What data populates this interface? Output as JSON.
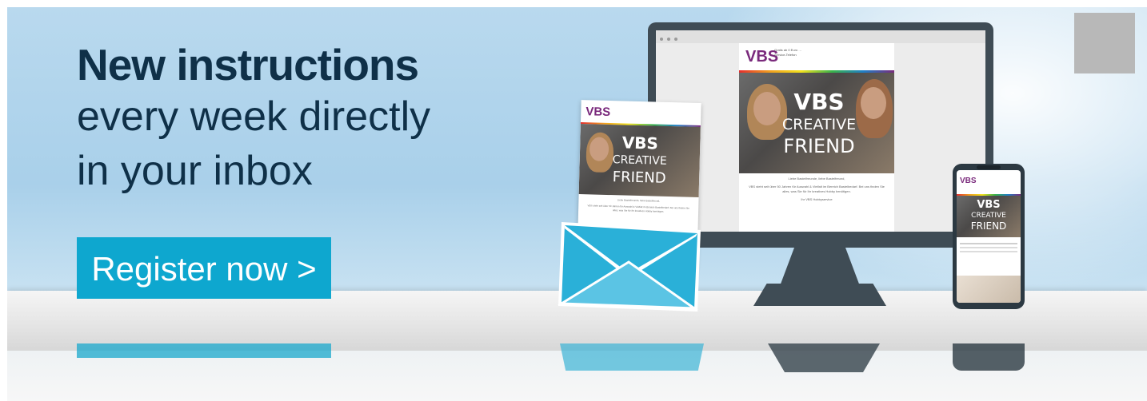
{
  "headline": {
    "line1": "New instructions",
    "line2": "every week directly",
    "line3": "in your inbox"
  },
  "cta": {
    "label": "Register now >"
  },
  "newsletter": {
    "logo": "VBS",
    "image_line1": "VBS",
    "image_line2": "CREATIVE",
    "image_line3": "FRIEND",
    "header_line1": "Gratis ab 0 Euro …",
    "header_line2": "Service-Telefon",
    "greeting": "Liebe Bastelfreunde, liebe Bastelfreund,",
    "body": "VBS steht seit über 50 Jahren für Auswahl & Vielfalt im Bereich Bastelbedarf. Bei uns finden Sie alles, was Sie für Ihr kreatives Hobby benötigen.",
    "signature": "Ihr VBS Hobbyservice"
  },
  "colors": {
    "headline": "#0f3048",
    "cta_background": "#0ea7cf",
    "device_body": "#3f4c55",
    "envelope": "#3cb3d6",
    "logo": "#7a2a7c"
  }
}
